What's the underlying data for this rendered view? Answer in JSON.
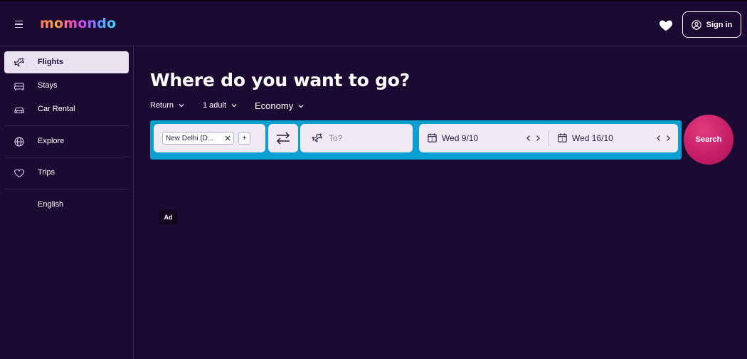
{
  "header": {
    "logo_text": "momondo",
    "signin_label": "Sign in",
    "icons": [
      "menu-icon",
      "heart-icon",
      "user-icon"
    ]
  },
  "sidebar": {
    "items": [
      {
        "label": "Flights",
        "icon": "plane-icon",
        "active": true
      },
      {
        "label": "Stays",
        "icon": "bed-icon",
        "active": false
      },
      {
        "label": "Car Rental",
        "icon": "car-icon",
        "active": false
      },
      {
        "label": "Explore",
        "icon": "globe-icon",
        "active": false
      },
      {
        "label": "Trips",
        "icon": "heart-outline-icon",
        "active": false
      },
      {
        "label": "English",
        "icon": "",
        "active": false
      }
    ]
  },
  "main": {
    "headline": "Where do you want to go?",
    "trip_type": "Return",
    "travellers": "1 adult",
    "cabin_class": "Economy",
    "origin_chip": "New Delhi (D...",
    "plus_label": "+",
    "destination_placeholder": "To?",
    "depart_date": "Wed 9/10",
    "return_date": "Wed 16/10",
    "search_label": "Search",
    "ad_label": "Ad"
  },
  "colors": {
    "background": "#1d0a33",
    "search_bar": "#0a9fd1",
    "search_button": "#c61e66",
    "field_bg": "#efeaf4",
    "active_nav_bg": "#e9e3f1"
  }
}
